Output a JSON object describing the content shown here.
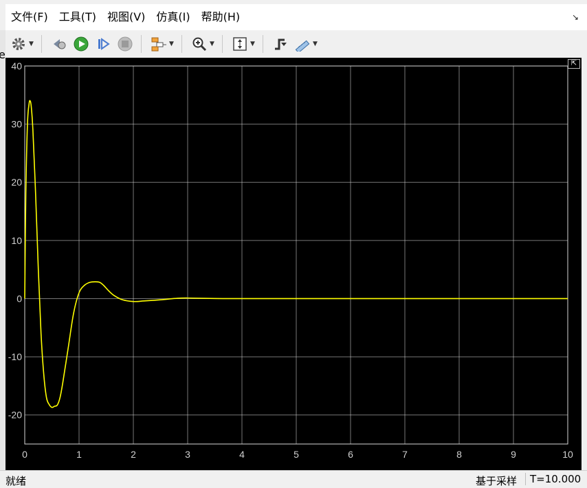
{
  "menu": [
    "文件(F)",
    "工具(T)",
    "视图(V)",
    "仿真(I)",
    "帮助(H)"
  ],
  "menu_corner": "↘",
  "left_fragment": "e",
  "status": {
    "left": "就绪",
    "mid": "基于采样",
    "right": "T=10.000"
  },
  "icons": [
    "gear-icon",
    "step-back-icon",
    "run-icon",
    "step-forward-icon",
    "stop-icon",
    "signal-selector-icon",
    "zoom-in-icon",
    "autoscale-icon",
    "triggers-icon",
    "cursor-measurement-icon"
  ],
  "colors": {
    "background": "#000000",
    "grid": "#d9d9d9",
    "line": "#ffff00",
    "axis_text": "#d0d0d0"
  },
  "chart_data": {
    "type": "line",
    "title": "",
    "xlabel": "",
    "ylabel": "",
    "xlim": [
      0,
      10
    ],
    "ylim": [
      -25,
      40
    ],
    "xticks": [
      0,
      1,
      2,
      3,
      4,
      5,
      6,
      7,
      8,
      9,
      10
    ],
    "yticks": [
      40,
      30,
      20,
      10,
      0,
      -10,
      -20
    ],
    "grid": true,
    "series": [
      {
        "color": "#ffff00",
        "x": [
          0,
          0.02,
          0.05,
          0.08,
          0.1,
          0.12,
          0.15,
          0.2,
          0.25,
          0.3,
          0.35,
          0.4,
          0.45,
          0.5,
          0.55,
          0.6,
          0.65,
          0.7,
          0.8,
          0.9,
          1.0,
          1.1,
          1.2,
          1.3,
          1.38,
          1.45,
          1.55,
          1.65,
          1.8,
          2.0,
          2.2,
          2.5,
          2.8,
          3.0,
          3.5,
          4.0,
          5.0,
          10.0
        ],
        "y": [
          0,
          18,
          30,
          33.5,
          34,
          33,
          29,
          18,
          5,
          -6,
          -13,
          -17,
          -18.2,
          -18.7,
          -18.5,
          -18.3,
          -17,
          -14.5,
          -8.5,
          -2.5,
          1.0,
          2.3,
          2.8,
          2.9,
          2.8,
          2.3,
          1.3,
          0.5,
          -0.2,
          -0.5,
          -0.4,
          -0.2,
          0.05,
          0.1,
          0.02,
          0,
          0,
          0
        ]
      }
    ]
  }
}
